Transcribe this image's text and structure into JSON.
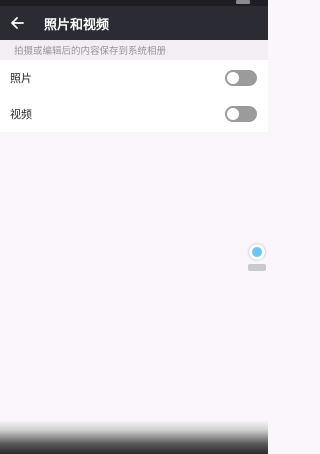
{
  "header": {
    "title": "照片和视频"
  },
  "description": "拍摄或编辑后的内容保存到系统相册",
  "settings": [
    {
      "label": "照片",
      "enabled": false
    },
    {
      "label": "视频",
      "enabled": false
    }
  ],
  "colors": {
    "app_bar": "#2b2b33",
    "background": "#fbf6fb",
    "toggle_off": "#9b9b9b",
    "float_ball": "#6fc5f2"
  },
  "icons": {
    "back": "arrow-left-icon"
  }
}
